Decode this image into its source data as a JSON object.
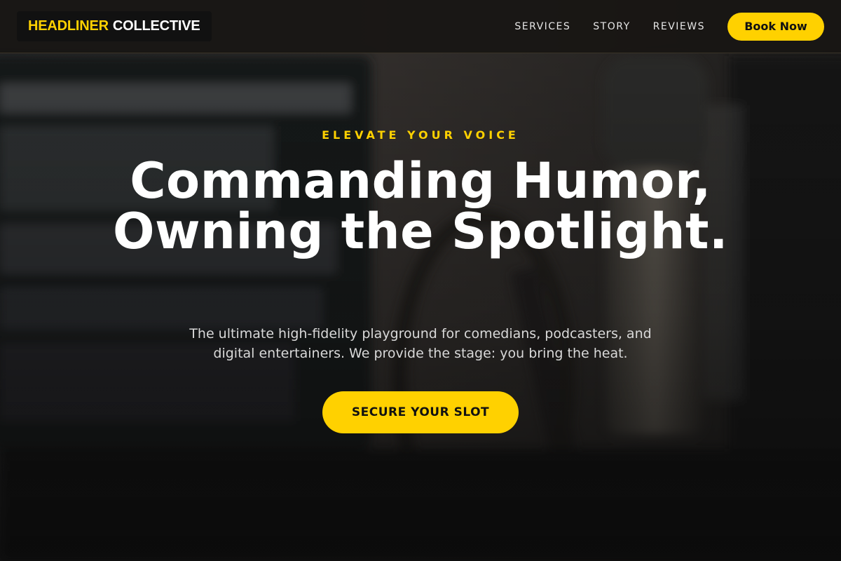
{
  "nav": {
    "logo_accent": "HEADLINER",
    "logo_rest": "COLLECTIVE",
    "links": [
      {
        "label": "SERVICES"
      },
      {
        "label": "STORY"
      },
      {
        "label": "REVIEWS"
      }
    ],
    "book_label": "Book Now"
  },
  "hero": {
    "eyebrow": "ELEVATE YOUR VOICE",
    "headline": "Commanding Humor, Owning the Spotlight.",
    "subtext": "The ultimate high-fidelity playground for comedians, podcasters, and digital entertainers. We provide the stage: you bring the heat.",
    "cta_label": "SECURE YOUR SLOT"
  },
  "colors": {
    "accent": "#ffd100",
    "nav_bg": "#181614",
    "text_primary": "#ffffff"
  }
}
